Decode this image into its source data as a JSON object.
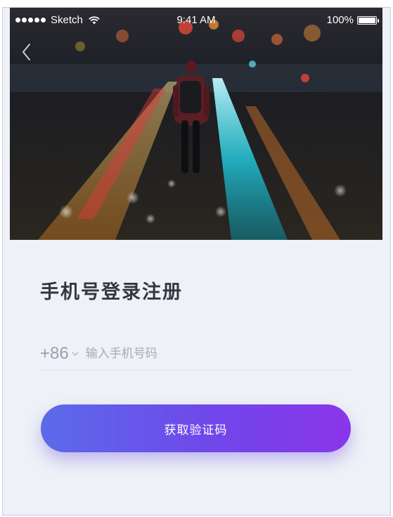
{
  "status_bar": {
    "carrier": "Sketch",
    "time": "9:41 AM",
    "battery": "100%",
    "signal_icon": "signal-dots-icon",
    "wifi_icon": "wifi-icon",
    "battery_icon": "battery-icon"
  },
  "nav": {
    "back_icon": "back-chevron-icon"
  },
  "form": {
    "title": "手机号登录注册",
    "country_code": "+86",
    "country_code_icon": "chevron-down-icon",
    "phone_value": "",
    "phone_placeholder": "输入手机号码",
    "submit_label": "获取验证码"
  },
  "colors": {
    "background": "#eef1f7",
    "title": "#333740",
    "muted": "#9aa0ab",
    "button_start": "#5b6bea",
    "button_end": "#8b35ea"
  }
}
